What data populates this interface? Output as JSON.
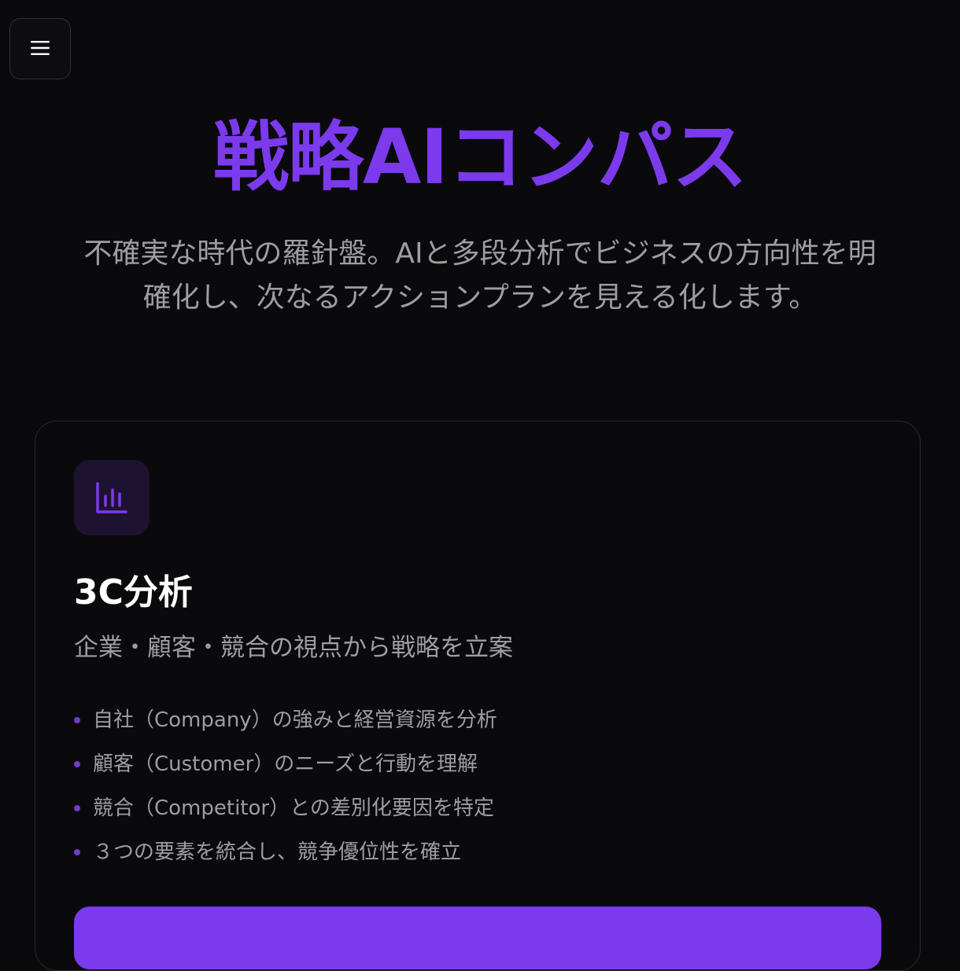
{
  "header": {
    "menu_icon": "hamburger-menu-icon"
  },
  "hero": {
    "title": "戦略AIコンパス",
    "subtitle_line1": "不確実な時代の羅針盤。AIと多段分析でビジネスの方向性を明",
    "subtitle_line2": "確化し、次なるアクションプランを見える化します。"
  },
  "card": {
    "icon": "bar-chart-icon",
    "title": "3C分析",
    "subtitle": "企業・顧客・競合の視点から戦略を立案",
    "features": [
      "自社（Company）の強みと経営資源を分析",
      "顧客（Customer）のニーズと行動を理解",
      "競合（Competitor）との差別化要因を特定",
      "３つの要素を統合し、競争優位性を確立"
    ]
  },
  "colors": {
    "accent": "#7c3aed",
    "background": "#0a0a0c",
    "text_muted": "#9d9da4",
    "icon_bg": "#1d1230"
  }
}
